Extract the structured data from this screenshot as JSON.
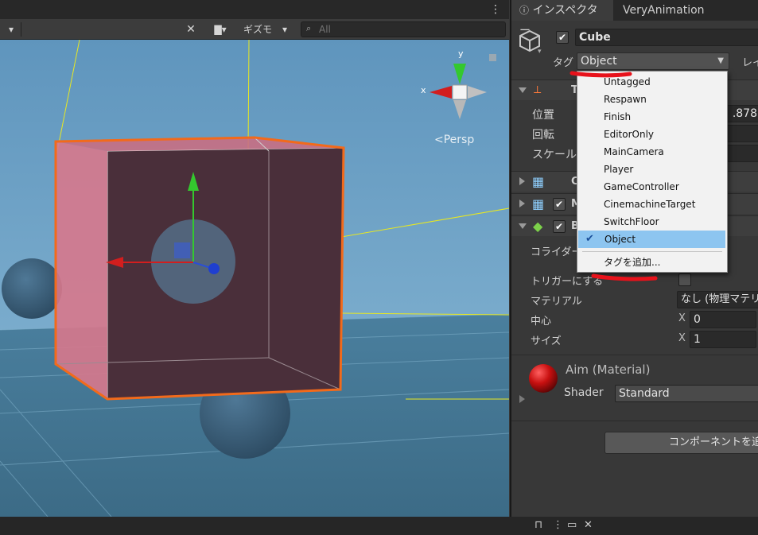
{
  "scene": {
    "toolbar": {
      "gizmos_label": "ギズモ",
      "search_placeholder": "All"
    },
    "camera_label": "Persp",
    "axis_x": "x",
    "axis_y": "y"
  },
  "inspector": {
    "tabs": [
      {
        "label": "インスペクター",
        "icon": "info-icon"
      },
      {
        "label": "VeryAnimation"
      }
    ],
    "object": {
      "name": "Cube",
      "active": true,
      "tag_label": "タグ",
      "tag_value": "Object",
      "layer_label": "レイ"
    },
    "transform": {
      "header": "T",
      "position_label": "位置",
      "rotation_label": "回転",
      "scale_label": "スケール",
      "position_z": ".878"
    },
    "components": [
      {
        "title": "C",
        "icon": "grid-icon"
      },
      {
        "title": "M",
        "icon": "mesh-renderer-icon",
        "enabled": true
      },
      {
        "title": "B",
        "icon": "box-collider-icon",
        "enabled": true
      }
    ],
    "box_collider": {
      "edit_label": "コライダーの",
      "trigger_label": "トリガーにする",
      "material_label": "マテリアル",
      "material_value": "なし (物理マテリア",
      "center_label": "中心",
      "center_x": "0",
      "size_label": "サイズ",
      "size_x": "1",
      "x_axis_label": "X"
    },
    "material": {
      "name": "Aim (Material)",
      "shader_label": "Shader",
      "shader_value": "Standard",
      "color": "#c81010"
    },
    "add_component_label": "コンポーネントを追加"
  },
  "tag_menu": {
    "items": [
      {
        "label": "Untagged"
      },
      {
        "label": "Respawn"
      },
      {
        "label": "Finish"
      },
      {
        "label": "EditorOnly"
      },
      {
        "label": "MainCamera"
      },
      {
        "label": "Player"
      },
      {
        "label": "GameController"
      },
      {
        "label": "CinemachineTarget"
      },
      {
        "label": "SwitchFloor"
      },
      {
        "label": "Object",
        "selected": true
      }
    ],
    "add_tag_label": "タグを追加..."
  },
  "colors": {
    "selection_outline": "#f26a1b",
    "annotation": "#e8121b",
    "menu_selected": "#8dc5f0"
  }
}
